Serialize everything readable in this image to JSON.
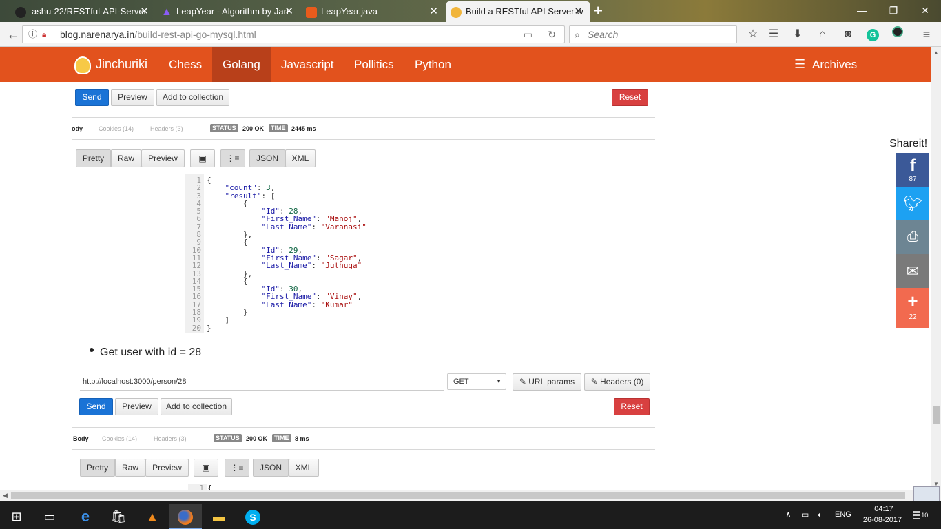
{
  "browser": {
    "tabs": [
      {
        "title": "ashu-22/RESTful-API-Server",
        "icon": "github-icon"
      },
      {
        "title": "LeapYear - Algorithm by Jan",
        "icon": "algorithm-icon"
      },
      {
        "title": "LeapYear.java",
        "icon": "java-icon"
      },
      {
        "title": "Build a RESTful API Server w",
        "icon": "blog-icon"
      }
    ],
    "new_tab": "+",
    "url_host": "blog.narenarya.in",
    "url_path": "/build-rest-api-go-mysql.html",
    "search_placeholder": "Search",
    "colors": {
      "tabbar": "#566147",
      "toolbar": "#f3f3f3"
    }
  },
  "site": {
    "brand": "Jinchuriki",
    "nav": [
      "Chess",
      "Golang",
      "Javascript",
      "Pollitics",
      "Python"
    ],
    "active_nav": "Golang",
    "archives": "Archives",
    "header_color": "#e2521d"
  },
  "request1": {
    "send": "Send",
    "preview": "Preview",
    "add_collection": "Add to collection",
    "reset": "Reset",
    "tab_body": "ody",
    "tab_cookies": "Cookies (14)",
    "tab_headers": "Headers (3)",
    "status_label": "STATUS",
    "status_value": "200 OK",
    "time_label": "TIME",
    "time_value": "2445 ms",
    "view_pretty": "Pretty",
    "view_raw": "Raw",
    "view_preview": "Preview",
    "fmt_json": "JSON",
    "fmt_xml": "XML"
  },
  "response_code": {
    "lines": [
      "1",
      "2",
      "3",
      "4",
      "5",
      "6",
      "7",
      "8",
      "9",
      "10",
      "11",
      "12",
      "13",
      "14",
      "15",
      "16",
      "17",
      "18",
      "19",
      "20"
    ]
  },
  "bullet": "Get user with id = 28",
  "request2": {
    "url": "http://localhost:3000/person/28",
    "method": "GET",
    "url_params": "URL params",
    "headers_btn": "Headers (0)",
    "send": "Send",
    "preview": "Preview",
    "add_collection": "Add to collection",
    "reset": "Reset",
    "tab_body": "Body",
    "tab_cookies": "Cookies (14)",
    "tab_headers": "Headers (3)",
    "status_label": "STATUS",
    "status_value": "200 OK",
    "time_label": "TIME",
    "time_value": "8 ms",
    "view_pretty": "Pretty",
    "view_raw": "Raw",
    "view_preview": "Preview",
    "fmt_json": "JSON",
    "fmt_xml": "XML",
    "first_line_no": "1"
  },
  "share": {
    "title": "Shareit!",
    "facebook_count": "87",
    "plus_count": "22",
    "colors": {
      "facebook": "#3b5998",
      "twitter": "#1da1f2",
      "print": "#6d8593",
      "email": "#7a7a7a",
      "plus": "#f26a4f"
    }
  },
  "taskbar": {
    "lang": "ENG",
    "time": "04:17",
    "date": "26-08-2017",
    "notifications": "10"
  }
}
